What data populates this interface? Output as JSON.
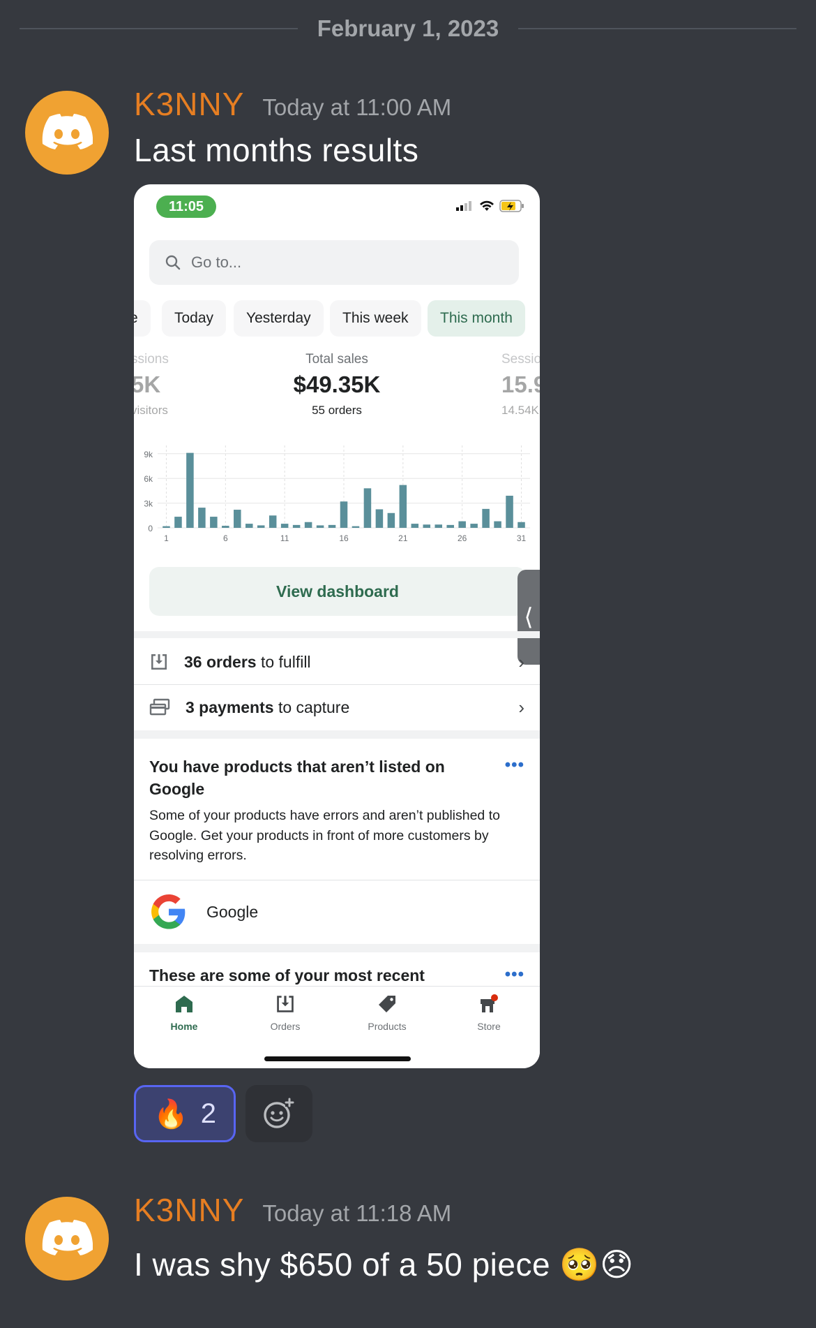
{
  "date_divider": "February 1, 2023",
  "messages": [
    {
      "username": "K3NNY",
      "timestamp": "Today at 11:00 AM",
      "text": "Last months results"
    },
    {
      "username": "K3NNY",
      "timestamp": "Today at 11:18 AM",
      "text": "I was shy $650 of a 50 piece 🥺😞"
    }
  ],
  "reaction": {
    "emoji": "🔥",
    "count": "2"
  },
  "colors": {
    "background": "#36393f",
    "username": "#e67e22",
    "avatar": "#f0a232",
    "reaction_border": "#5865f2",
    "accent_green": "#2e6b4f"
  },
  "screenshot": {
    "status_time": "11:05",
    "search_placeholder": "Go to...",
    "date_filters": [
      {
        "label": "e",
        "active": false
      },
      {
        "label": "Today",
        "active": false
      },
      {
        "label": "Yesterday",
        "active": false
      },
      {
        "label": "This week",
        "active": false
      },
      {
        "label": "This month",
        "active": true
      }
    ],
    "stats": {
      "left": {
        "label": "ssions",
        "value": "5K",
        "sub": "visitors"
      },
      "center": {
        "label": "Total sales",
        "value": "$49.35K",
        "sub": "55 orders"
      },
      "right": {
        "label": "Sessio",
        "value": "15.9",
        "sub": "14.54K"
      }
    },
    "view_dashboard": "View dashboard",
    "orders_row": {
      "bold": "36 orders",
      "rest": " to fulfill"
    },
    "payments_row": {
      "bold": "3 payments",
      "rest": " to capture"
    },
    "google_card": {
      "title": "You have products that aren’t listed on Google",
      "body": "Some of your products have errors and aren’t published to Google. Get your products in front of more customers by resolving errors.",
      "channel": "Google"
    },
    "recent_card_title": "These are some of your most recent",
    "tabs": [
      {
        "label": "Home",
        "icon": "home-icon"
      },
      {
        "label": "Orders",
        "icon": "orders-icon"
      },
      {
        "label": "Products",
        "icon": "tag-icon"
      },
      {
        "label": "Store",
        "icon": "store-icon"
      }
    ]
  },
  "chart_data": {
    "type": "bar",
    "ylim": [
      0,
      10000
    ],
    "yticks": [
      "0",
      "3k",
      "6k",
      "9k"
    ],
    "ytick_values": [
      0,
      3000,
      6000,
      9000
    ],
    "xticks": [
      "1",
      "6",
      "11",
      "16",
      "21",
      "26",
      "31"
    ],
    "categories": [
      1,
      2,
      3,
      4,
      5,
      6,
      7,
      8,
      9,
      10,
      11,
      12,
      13,
      14,
      15,
      16,
      17,
      18,
      19,
      20,
      21,
      22,
      23,
      24,
      25,
      26,
      27,
      28,
      29,
      30,
      31
    ],
    "values": [
      200,
      1350,
      9100,
      2450,
      1350,
      250,
      2200,
      500,
      300,
      1500,
      500,
      350,
      700,
      300,
      350,
      3200,
      200,
      4800,
      2250,
      1800,
      5200,
      500,
      400,
      400,
      350,
      800,
      500,
      2300,
      800,
      3900,
      700
    ],
    "grid": true
  }
}
